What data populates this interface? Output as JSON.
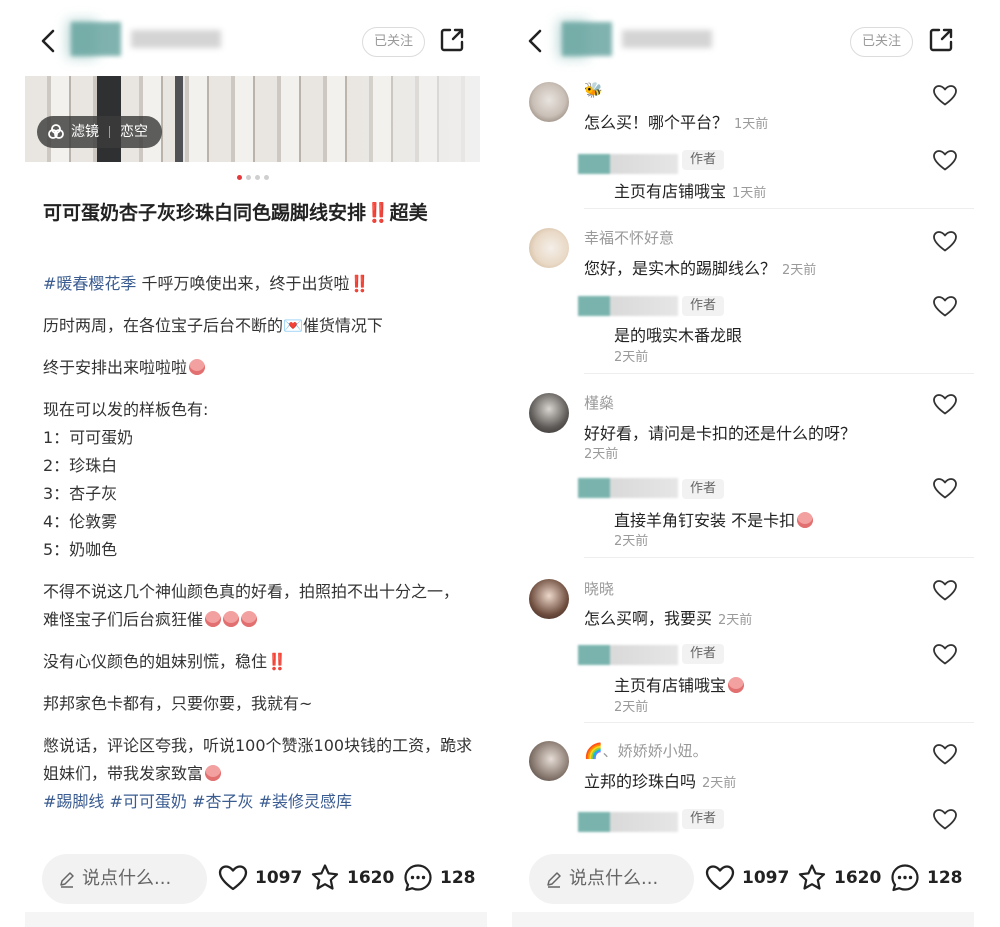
{
  "header": {
    "follow_label": "已关注"
  },
  "post": {
    "filter_label": "滤镜",
    "filter_name": "恋空",
    "title": "可可蛋奶杏子灰珍珠白同色踢脚线安排‼️超美",
    "paragraphs": [
      {
        "tag": "#暖春樱花季",
        "text": " 千呼万唤使出来，终于出货啦‼️"
      },
      {
        "text": "历时两周，在各位宝子后台不断的💌催货情况下"
      },
      {
        "text": "终于安排出来啦啦啦"
      },
      {
        "text": "现在可以发的样板色有:"
      }
    ],
    "colors": [
      "1：可可蛋奶",
      "2：珍珠白",
      "3：杏子灰",
      "4：伦敦雾",
      "5：奶咖色"
    ],
    "para_after": [
      "不得不说这几个神仙颜色真的好看，拍照拍不出十分之一，难怪宝子们后台疯狂催",
      "没有心仪颜色的姐妹别慌，稳住‼️",
      "邦邦家色卡都有，只要你要，我就有~",
      "憋说话，评论区夸我，听说100个赞涨100块钱的工资，跪求姐妹们，带我发家致富"
    ],
    "tags": [
      "#踢脚线",
      "#可可蛋奶",
      "#杏子灰",
      "#装修灵感库"
    ]
  },
  "bottom_bar": {
    "input_placeholder": "说点什么...",
    "likes": "1097",
    "stars": "1620",
    "comments": "128"
  },
  "comments": [
    {
      "name": "🐝",
      "text": "怎么买！哪个平台？",
      "time": "1天前",
      "reply": {
        "badge": "作者",
        "text": "主页有店铺哦宝",
        "time": "1天前"
      }
    },
    {
      "name": "幸福不怀好意",
      "text": "您好，是实木的踢脚线么？",
      "time": "2天前",
      "reply": {
        "badge": "作者",
        "text": "是的哦实木番龙眼",
        "time": "2天前"
      }
    },
    {
      "name": "槿燊",
      "text": "好好看，请问是卡扣的还是什么的呀？",
      "time": "2天前",
      "reply": {
        "badge": "作者",
        "text": "直接羊角钉安装 不是卡扣",
        "time": "2天前"
      }
    },
    {
      "name": "晓晓",
      "text": "怎么买啊，我要买",
      "time": "2天前",
      "reply": {
        "badge": "作者",
        "text": "主页有店铺哦宝",
        "time": "2天前"
      }
    },
    {
      "name": "🌈、娇娇娇小妞。",
      "text": "立邦的珍珠白吗",
      "time": "2天前",
      "reply": {
        "badge": "作者"
      }
    }
  ],
  "colors": {
    "accent_red": "#e5393c",
    "tag_blue": "#3b5c91",
    "muted": "#9a9a9a"
  }
}
